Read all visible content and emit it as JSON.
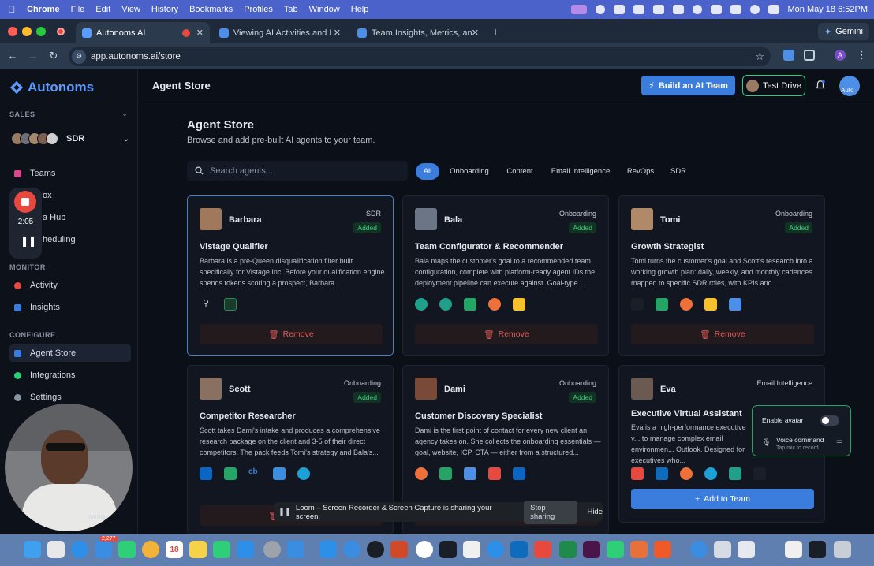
{
  "menubar": {
    "items": [
      "Chrome",
      "File",
      "Edit",
      "View",
      "History",
      "Bookmarks",
      "Profiles",
      "Tab",
      "Window",
      "Help"
    ],
    "datetime": "Mon May 18  6:52PM"
  },
  "browser": {
    "tabs": [
      {
        "label": "Autonoms AI",
        "active": true
      },
      {
        "label": "Viewing AI Activities and Live",
        "active": false
      },
      {
        "label": "Team Insights, Metrics, and M",
        "active": false
      }
    ],
    "gemini_label": "Gemini",
    "url": "app.autonoms.ai/store",
    "profile_initial": "A"
  },
  "sidebar": {
    "logo": "Autonoms",
    "sales_section": "SALES",
    "team_name": "SDR",
    "items_main": [
      {
        "label": "Teams",
        "color": "#d9478c"
      },
      {
        "label": "ox",
        "color": "#3aa0e8"
      },
      {
        "label": "a Hub",
        "color": "#6b7cff"
      },
      {
        "label": "heduling",
        "color": "#e8a23a"
      }
    ],
    "monitor_section": "MONITOR",
    "items_monitor": [
      {
        "label": "Activity",
        "color": "#e8493f"
      },
      {
        "label": "Insights",
        "color": "#3b7ddd"
      }
    ],
    "configure_section": "CONFIGURE",
    "items_configure": [
      {
        "label": "Agent Store",
        "color": "#3b7ddd",
        "active": true
      },
      {
        "label": "Integrations",
        "color": "#2fcf7a"
      },
      {
        "label": "Settings",
        "color": "#8a93a3"
      }
    ],
    "recorder_time": "2:05",
    "footer_text": "nomis-"
  },
  "topbar": {
    "title": "Agent Store",
    "build_label": "Build an AI Team",
    "test_label": "Test Drive",
    "avatar_text": "Auto"
  },
  "main": {
    "title": "Agent Store",
    "subtitle": "Browse and add pre-built AI agents to your team.",
    "search_placeholder": "Search agents...",
    "filters": [
      "All",
      "Onboarding",
      "Content",
      "Email Intelligence",
      "RevOps",
      "SDR"
    ],
    "remove_label": "Remove",
    "add_label": "Add to Team",
    "added_label": "Added",
    "agents": [
      {
        "name": "Barbara",
        "category": "SDR",
        "role": "Vistage Qualifier",
        "description": "Barbara is a pre-Queen disqualification filter built specifically for Vistage Inc. Before your qualification engine spends tokens scoring a prospect, Barbara...",
        "status": "added",
        "icons": [
          "key-icon",
          "sheet-icon"
        ]
      },
      {
        "name": "Bala",
        "category": "Onboarding",
        "role": "Team Configurator & Recommender",
        "description": "Bala maps the customer's goal to a recommended team configuration, complete with platform-ready agent IDs the deployment pipeline can execute against. Goal-type...",
        "status": "added",
        "icons": [
          "hub-icon",
          "hub-icon",
          "sheets-icon",
          "hubspot-icon",
          "sheets-yellow-icon"
        ]
      },
      {
        "name": "Tomi",
        "category": "Onboarding",
        "role": "Growth Strategist",
        "description": "Tomi turns the customer's goal and Scott's research into a working growth plan: daily, weekly, and monthly cadences mapped to specific SDR roles, with KPIs and...",
        "status": "added",
        "icons": [
          "dark-icon",
          "sheets-icon",
          "hubspot-icon",
          "sheets-yellow-icon",
          "calendar-icon"
        ]
      },
      {
        "name": "Scott",
        "category": "Onboarding",
        "role": "Competitor Researcher",
        "description": "Scott takes Dami's intake and produces a comprehensive research package on the client and 3-5 of their direct competitors. The pack feeds Tomi's strategy and Bala's...",
        "status": "added",
        "icons": [
          "linkedin-icon",
          "sheets-icon",
          "crunchbase-icon",
          "docs-icon",
          "salesforce-icon"
        ]
      },
      {
        "name": "Dami",
        "category": "Onboarding",
        "role": "Customer Discovery Specialist",
        "description": "Dami is the first point of contact for every new client an agency takes on. She collects the onboarding essentials — goal, website, ICP, CTA — either from a structured...",
        "status": "added",
        "icons": [
          "hubspot-icon",
          "sheets-icon",
          "calendar-icon",
          "gmail-icon",
          "linkedin-icon"
        ]
      },
      {
        "name": "Eva",
        "category": "Email Intelligence",
        "role": "Executive Virtual Assistant",
        "description": "Eva is a high-performance executive v... to manage complex email environmen... Outlook. Designed for executives who...",
        "status": "available",
        "icons": [
          "gmail-icon",
          "outlook-icon",
          "hubspot-icon",
          "salesforce-icon",
          "teal-icon",
          "dark-icon"
        ]
      }
    ]
  },
  "voice_popup": {
    "enable_avatar": "Enable avatar",
    "voice_command": "Voice command",
    "voice_sub": "Tap mic to record"
  },
  "loom": {
    "message": "Loom – Screen Recorder & Screen Capture is sharing your screen.",
    "stop_label": "Stop sharing",
    "hide_label": "Hide"
  },
  "dock": {
    "badge_mail": "2,277",
    "calendar_day": "18"
  }
}
